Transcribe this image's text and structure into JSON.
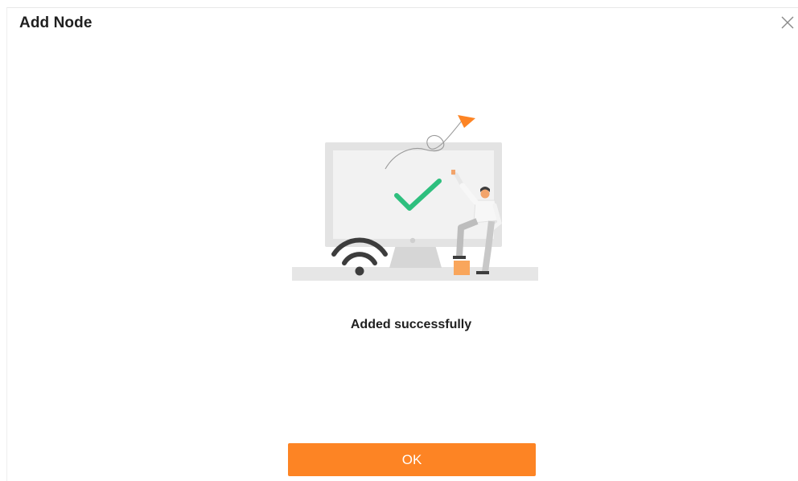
{
  "dialog": {
    "title": "Add Node",
    "close_icon": "close-icon",
    "illustration_icons": [
      "monitor-icon",
      "checkmark-icon",
      "wifi-icon",
      "person-icon",
      "arrow-icon"
    ],
    "status_text": "Added successfully",
    "ok_label": "OK"
  },
  "colors": {
    "accent": "#fd8424",
    "check": "#2ebf7e",
    "wifi": "#3d3d3d",
    "title_text": "#1f1f1f"
  }
}
